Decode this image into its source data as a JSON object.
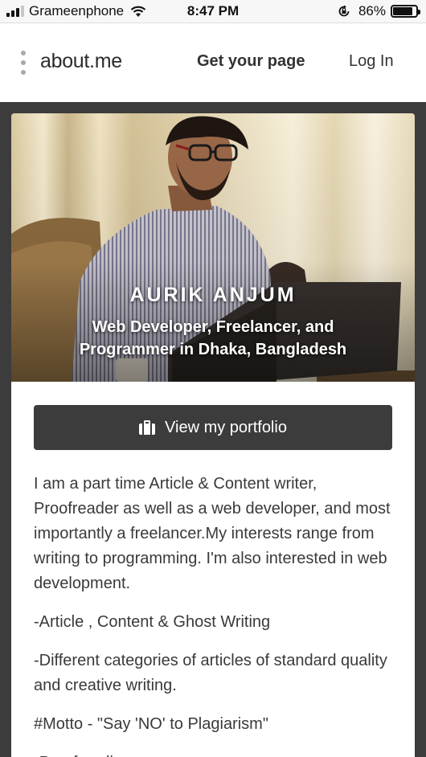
{
  "status_bar": {
    "carrier": "Grameenphone",
    "time": "8:47 PM",
    "battery": "86%",
    "battery_level": 0.86
  },
  "nav": {
    "logo": "about.me",
    "get_page": "Get your page",
    "login": "Log In"
  },
  "profile": {
    "name": "AURIK ANJUM",
    "title": "Web Developer, Freelancer, and Programmer in Dhaka, Bangladesh",
    "portfolio_button": "View my portfolio",
    "bio": [
      "I am a part time Article & Content writer, Proofreader as well as a web developer, and most importantly a freelancer.My interests range from writing to programming. I'm also interested in web development.",
      "-Article , Content & Ghost Writing",
      "-Different categories of articles of standard quality and creative writing.",
      "#Motto - \"Say 'NO' to Plagiarism\"",
      "-Proofreading"
    ]
  },
  "icons": {
    "menu": "dots-menu-icon",
    "portfolio": "briefcase-icon",
    "wifi": "wifi-icon",
    "battery": "battery-icon",
    "rotation_lock": "rotation-lock-icon"
  },
  "colors": {
    "page_bg": "#3c3c3c",
    "button_bg": "#3c3c3c",
    "text": "#3a3a3a"
  }
}
